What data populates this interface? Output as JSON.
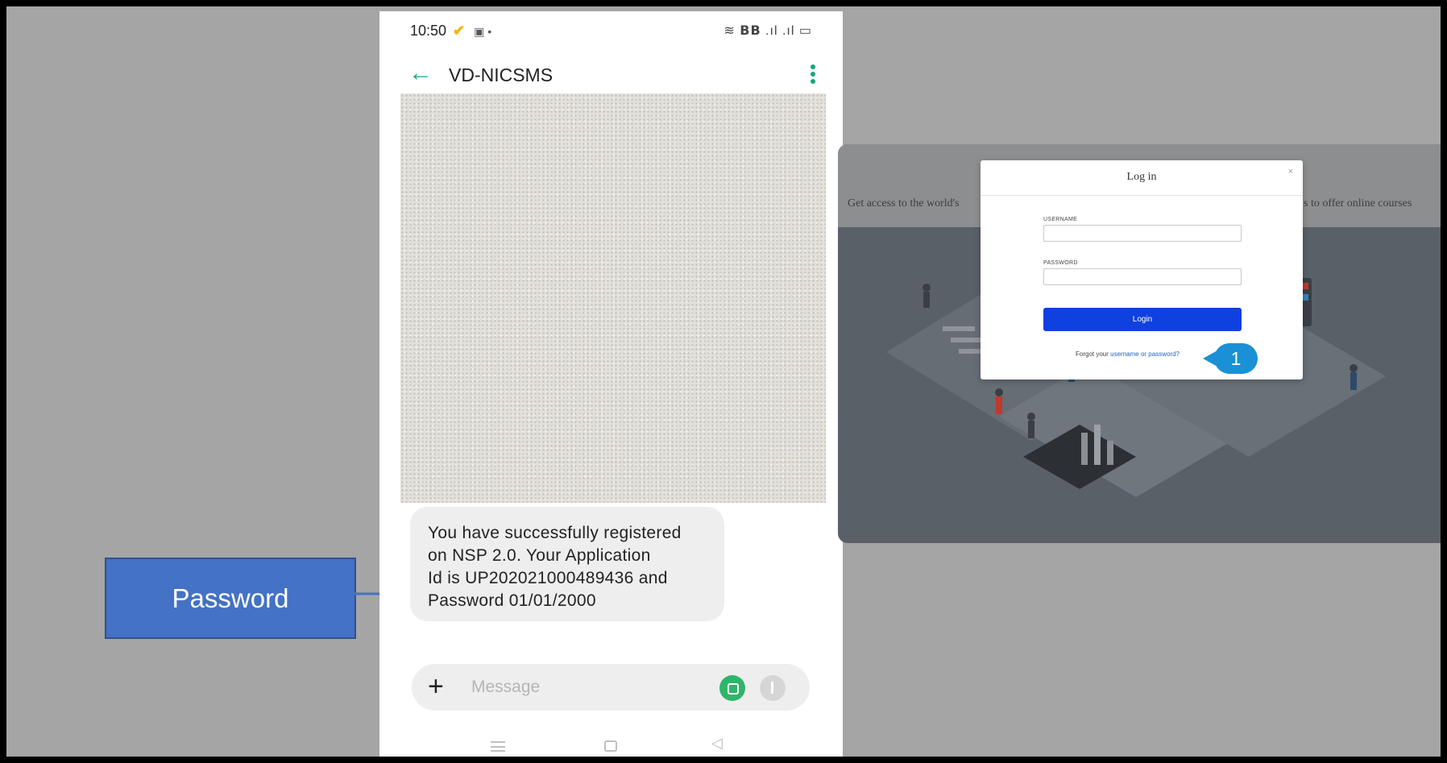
{
  "phone": {
    "status_time": "10:50",
    "status_right": "≋ 𝗕𝗕 .ıl .ıl ▭",
    "sender": "VD-NICSMS",
    "message_lines": [
      "You have successfully registered",
      "on NSP 2.0. Your Application",
      "Id is UP202021000489436 and",
      "Password 01/01/2000"
    ],
    "composer_placeholder": "Message",
    "back_icon": "←",
    "plus_icon": "+",
    "nav_back_icon": "◁"
  },
  "callout": {
    "label": "Password"
  },
  "website": {
    "band_left": "Get access to the world's",
    "band_right": "s to offer online courses"
  },
  "login": {
    "title": "Log in",
    "close": "×",
    "username_label": "USERNAME",
    "password_label": "PASSWORD",
    "button": "Login",
    "forgot_prefix": "Forgot your ",
    "forgot_link": "username or password?"
  },
  "step_badge": "1",
  "colors": {
    "backdrop": "#a5a5a5",
    "callout": "#4472c4",
    "accent_green": "#18a77a",
    "login_button": "#0f40e0",
    "badge": "#1a90d6"
  }
}
